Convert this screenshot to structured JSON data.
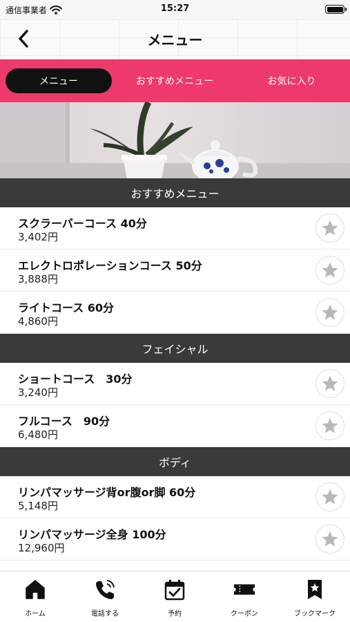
{
  "status_bar": {
    "carrier": "通信事業者",
    "time": "15:27"
  },
  "nav": {
    "title": "メニュー"
  },
  "tabs": [
    {
      "label": "メニュー",
      "active": true
    },
    {
      "label": "おすすめメニュー",
      "active": false
    },
    {
      "label": "お気に入り",
      "active": false
    }
  ],
  "sections": [
    {
      "title": "おすすめメニュー",
      "items": [
        {
          "name": "スクラーバーコース 40分",
          "price": "3,402円"
        },
        {
          "name": "エレクトロポレーションコース 50分",
          "price": "3,888円"
        },
        {
          "name": "ライトコース 60分",
          "price": "4,860円"
        }
      ]
    },
    {
      "title": "フェイシャル",
      "items": [
        {
          "name": "ショートコース　30分",
          "price": "3,240円"
        },
        {
          "name": "フルコース　90分",
          "price": "6,480円"
        }
      ]
    },
    {
      "title": "ボディ",
      "items": [
        {
          "name": "リンパマッサージ背or腹or脚 60分",
          "price": "5,148円"
        },
        {
          "name": "リンパマッサージ全身 100分",
          "price": "12,960円"
        }
      ]
    }
  ],
  "bottom_tabs": [
    {
      "label": "ホーム",
      "icon": "home-icon"
    },
    {
      "label": "電話する",
      "icon": "phone-icon"
    },
    {
      "label": "予約",
      "icon": "calendar-check-icon"
    },
    {
      "label": "クーポン",
      "icon": "coupon-ticket-icon"
    },
    {
      "label": "ブックマーク",
      "icon": "bookmark-star-icon"
    }
  ],
  "colors": {
    "accent": "#ee3a6a",
    "section_bg": "#3a3a3a",
    "star": "#b8b8b8"
  }
}
